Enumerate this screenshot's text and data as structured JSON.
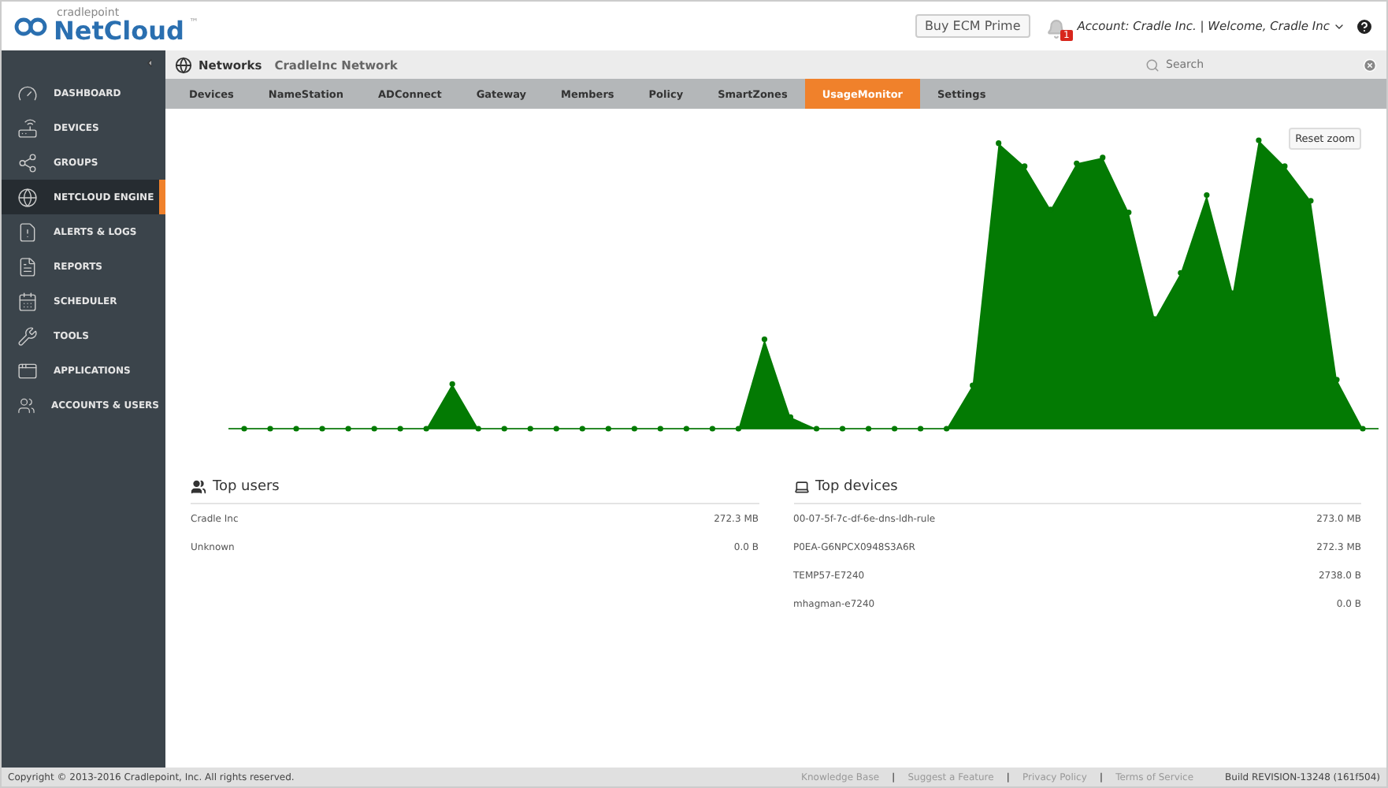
{
  "header": {
    "brand_small": "cradlepoint",
    "brand": "NetCloud",
    "brand_mark": "™",
    "buy_button": "Buy ECM Prime",
    "notification_count": "1",
    "account": "Account: Cradle Inc. | Welcome, Cradle Inc"
  },
  "sidebar": {
    "items": [
      {
        "label": "DASHBOARD",
        "kind": "dashboard",
        "selected": false
      },
      {
        "label": "DEVICES",
        "kind": "devices",
        "selected": false
      },
      {
        "label": "GROUPS",
        "kind": "groups",
        "selected": false
      },
      {
        "label": "NETCLOUD ENGINE",
        "kind": "engine",
        "selected": true
      },
      {
        "label": "ALERTS & LOGS",
        "kind": "alerts",
        "selected": false
      },
      {
        "label": "REPORTS",
        "kind": "reports",
        "selected": false
      },
      {
        "label": "SCHEDULER",
        "kind": "scheduler",
        "selected": false
      },
      {
        "label": "TOOLS",
        "kind": "tools",
        "selected": false
      },
      {
        "label": "APPLICATIONS",
        "kind": "applications",
        "selected": false
      },
      {
        "label": "ACCOUNTS & USERS",
        "kind": "accounts",
        "selected": false
      }
    ]
  },
  "breadcrumb": {
    "root": "Networks",
    "current": "CradleInc Network"
  },
  "search": {
    "placeholder": "Search"
  },
  "tabs": [
    {
      "label": "Devices",
      "selected": false
    },
    {
      "label": "NameStation",
      "selected": false
    },
    {
      "label": "ADConnect",
      "selected": false
    },
    {
      "label": "Gateway",
      "selected": false
    },
    {
      "label": "Members",
      "selected": false
    },
    {
      "label": "Policy",
      "selected": false
    },
    {
      "label": "SmartZones",
      "selected": false
    },
    {
      "label": "UsageMonitor",
      "selected": true
    },
    {
      "label": "Settings",
      "selected": false
    }
  ],
  "chart": {
    "reset_button": "Reset zoom"
  },
  "top_users": {
    "title": "Top users",
    "rows": [
      {
        "name": "Cradle Inc",
        "value": "272.3 MB"
      },
      {
        "name": "Unknown",
        "value": "0.0 B"
      }
    ]
  },
  "top_devices": {
    "title": "Top devices",
    "rows": [
      {
        "name": "00-07-5f-7c-df-6e-dns-ldh-rule",
        "value": "273.0 MB"
      },
      {
        "name": "P0EA-G6NPCX0948S3A6R",
        "value": "272.3 MB"
      },
      {
        "name": "TEMP57-E7240",
        "value": "2738.0 B"
      },
      {
        "name": "mhagman-e7240",
        "value": "0.0 B"
      }
    ]
  },
  "footer": {
    "copyright": "Copyright © 2013-2016 Cradlepoint, Inc. All rights reserved.",
    "links": [
      {
        "kind": "link",
        "label": "Knowledge Base"
      },
      {
        "kind": "separator",
        "label": "|"
      },
      {
        "kind": "link",
        "label": "Suggest a Feature"
      },
      {
        "kind": "separator",
        "label": "|"
      },
      {
        "kind": "link",
        "label": "Privacy Policy"
      },
      {
        "kind": "separator",
        "label": "|"
      },
      {
        "kind": "link",
        "label": "Terms of Service"
      }
    ],
    "build": "Build REVISION-13248 (161f504)"
  }
}
